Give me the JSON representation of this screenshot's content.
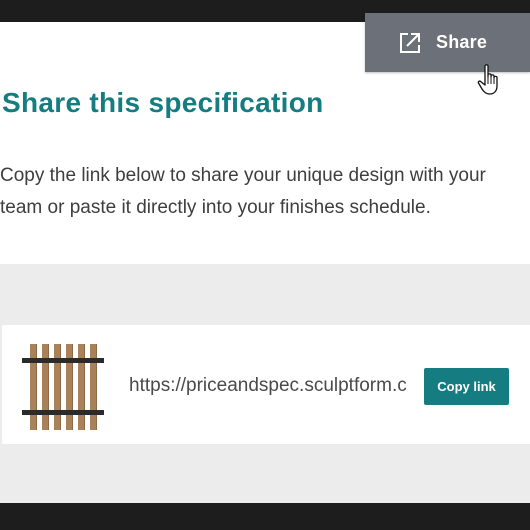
{
  "share": {
    "label": "Share",
    "icon": "share-external-icon"
  },
  "page": {
    "heading": "Share this specification",
    "description": "Copy the link below to share your unique design with your team or paste it directly into your finishes schedule."
  },
  "link": {
    "url": "https://priceandspec.sculptform.c",
    "copy_label": "Copy link",
    "thumbnail": "timber-batten-screen-thumbnail"
  },
  "colors": {
    "accent": "#157d82",
    "share_button": "#6c7078",
    "panel": "#ececec",
    "frame": "#1d1d1d",
    "timber": "#a9825a",
    "rail": "#2b2b2b"
  }
}
